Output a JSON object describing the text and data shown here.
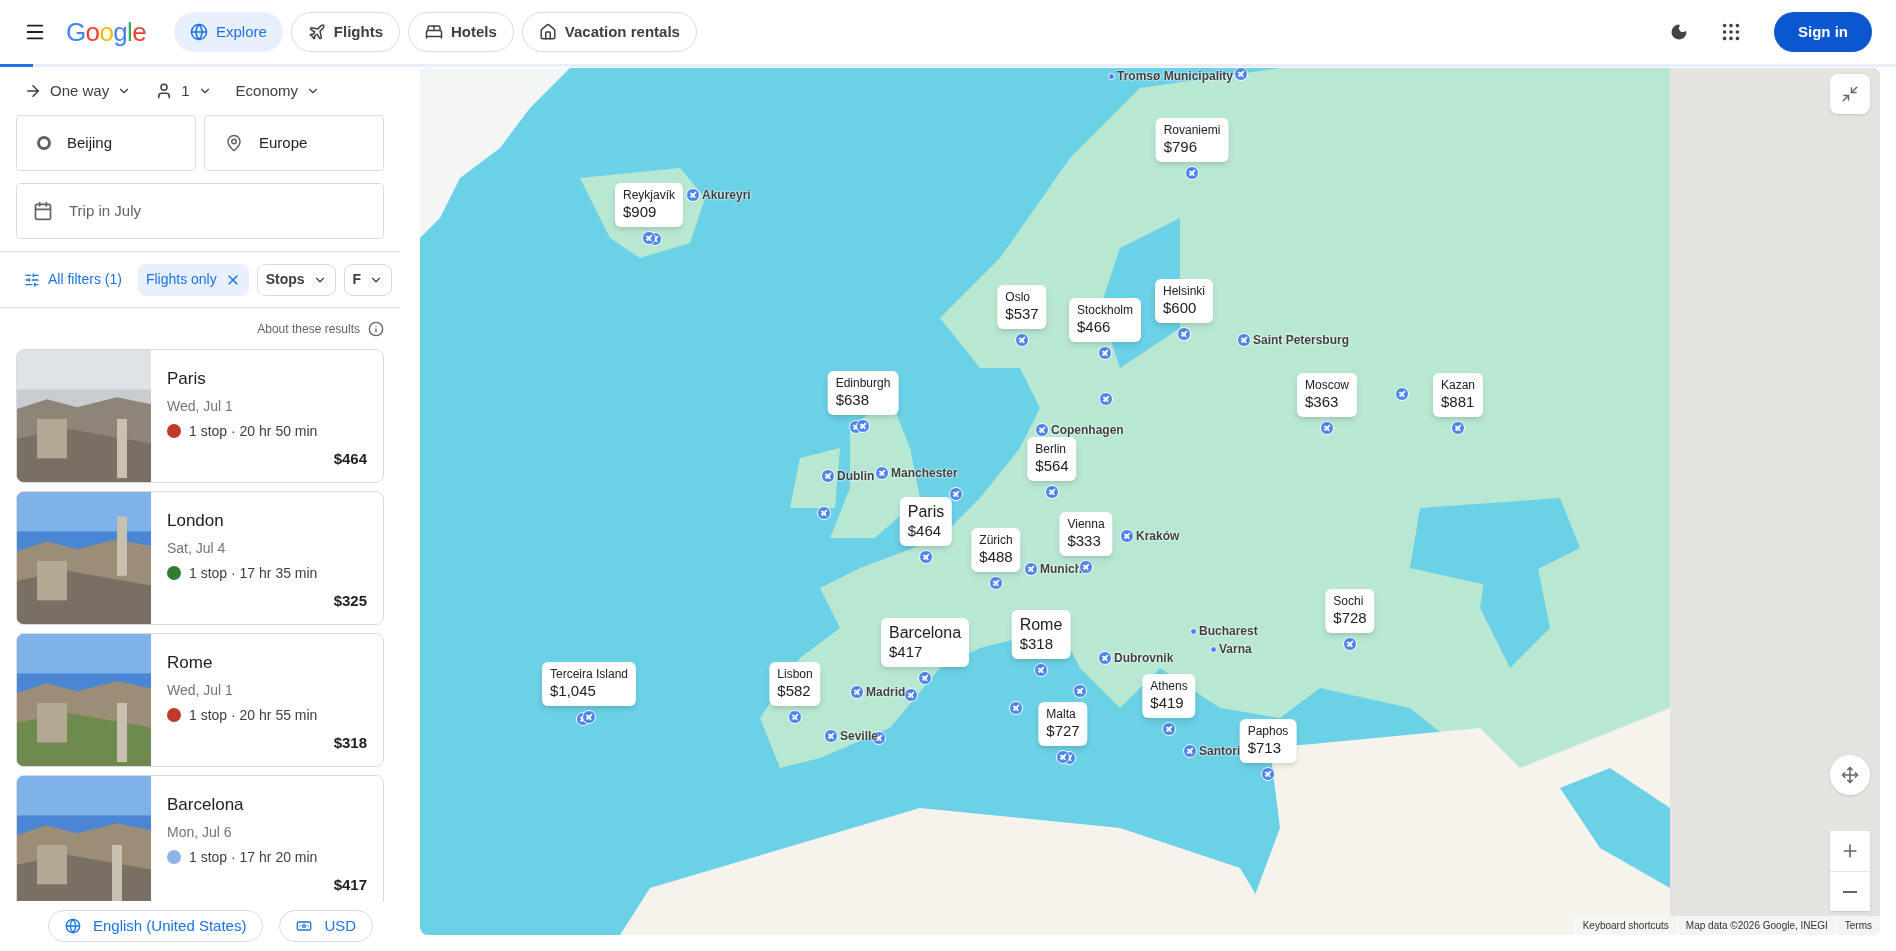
{
  "header": {
    "logo": "Google",
    "tabs": [
      {
        "label": "Explore",
        "selected": true,
        "kind": "explore"
      },
      {
        "label": "Flights",
        "selected": false,
        "kind": "flights"
      },
      {
        "label": "Hotels",
        "selected": false,
        "kind": "hotels"
      },
      {
        "label": "Vacation rentals",
        "selected": false,
        "kind": "rentals"
      }
    ],
    "sign_in": "Sign in"
  },
  "search": {
    "trip_type": "One way",
    "passengers": "1",
    "cabin": "Economy",
    "origin": "Beijing",
    "destination": "Europe",
    "date_placeholder": "Trip in July"
  },
  "filters": {
    "all_filters": "All filters (1)",
    "chips": [
      {
        "label": "Flights only",
        "selected": true
      },
      {
        "label": "Stops",
        "selected": false
      },
      {
        "label": "F",
        "selected": false
      }
    ]
  },
  "about": "About these results",
  "results": [
    {
      "city": "Paris",
      "date": "Wed, Jul 1",
      "details": "1 stop · 20 hr 50 min",
      "price": "$464",
      "color": "#c0392b"
    },
    {
      "city": "London",
      "date": "Sat, Jul 4",
      "details": "1 stop · 17 hr 35 min",
      "price": "$325",
      "color": "#2e7d32"
    },
    {
      "city": "Rome",
      "date": "Wed, Jul 1",
      "details": "1 stop · 20 hr 55 min",
      "price": "$318",
      "color": "#c0392b"
    },
    {
      "city": "Barcelona",
      "date": "Mon, Jul 6",
      "details": "1 stop · 17 hr 20 min",
      "price": "$417",
      "color": "#90b4e8"
    }
  ],
  "footer": {
    "language": "English (United States)",
    "currency": "USD"
  },
  "map": {
    "markers": [
      {
        "city": "Reykjavík",
        "price": "$909",
        "highlighted": false
      },
      {
        "city": "Rovaniemi",
        "price": "$796",
        "highlighted": false
      },
      {
        "city": "Oslo",
        "price": "$537",
        "highlighted": false
      },
      {
        "city": "Stockholm",
        "price": "$466",
        "highlighted": false
      },
      {
        "city": "Helsinki",
        "price": "$600",
        "highlighted": false
      },
      {
        "city": "Edinburgh",
        "price": "$638",
        "highlighted": false
      },
      {
        "city": "Moscow",
        "price": "$363",
        "highlighted": false
      },
      {
        "city": "Kazan",
        "price": "$881",
        "highlighted": false
      },
      {
        "city": "Berlin",
        "price": "$564",
        "highlighted": false
      },
      {
        "city": "Paris",
        "price": "$464",
        "highlighted": true
      },
      {
        "city": "Zürich",
        "price": "$488",
        "highlighted": false
      },
      {
        "city": "Vienna",
        "price": "$333",
        "highlighted": false
      },
      {
        "city": "Sochi",
        "price": "$728",
        "highlighted": false
      },
      {
        "city": "Barcelona",
        "price": "$417",
        "highlighted": true
      },
      {
        "city": "Rome",
        "price": "$318",
        "highlighted": true
      },
      {
        "city": "Terceira Island",
        "price": "$1,045",
        "highlighted": false
      },
      {
        "city": "Lisbon",
        "price": "$582",
        "highlighted": false
      },
      {
        "city": "Athens",
        "price": "$419",
        "highlighted": false
      },
      {
        "city": "Malta",
        "price": "$727",
        "highlighted": false
      },
      {
        "city": "Paphos",
        "price": "$713",
        "highlighted": false
      }
    ],
    "places": [
      {
        "name": "Tromsø Municipality",
        "kind": "dot"
      },
      {
        "name": "Akureyri",
        "kind": "airport"
      },
      {
        "name": "Saint Petersburg",
        "kind": "airport"
      },
      {
        "name": "Copenhagen",
        "kind": "airport"
      },
      {
        "name": "Dublin",
        "kind": "airport"
      },
      {
        "name": "Manchester",
        "kind": "airport"
      },
      {
        "name": "Kraków",
        "kind": "airport"
      },
      {
        "name": "Munich",
        "kind": "airport"
      },
      {
        "name": "Bucharest",
        "kind": "dot"
      },
      {
        "name": "Varna",
        "kind": "dot"
      },
      {
        "name": "Dubrovnik",
        "kind": "airport"
      },
      {
        "name": "Madrid",
        "kind": "airport"
      },
      {
        "name": "Seville",
        "kind": "airport"
      },
      {
        "name": "Santori",
        "kind": "airport"
      }
    ],
    "attribution": [
      "Keyboard shortcuts",
      "Map data ©2026 Google, INEGI",
      "Terms"
    ]
  }
}
